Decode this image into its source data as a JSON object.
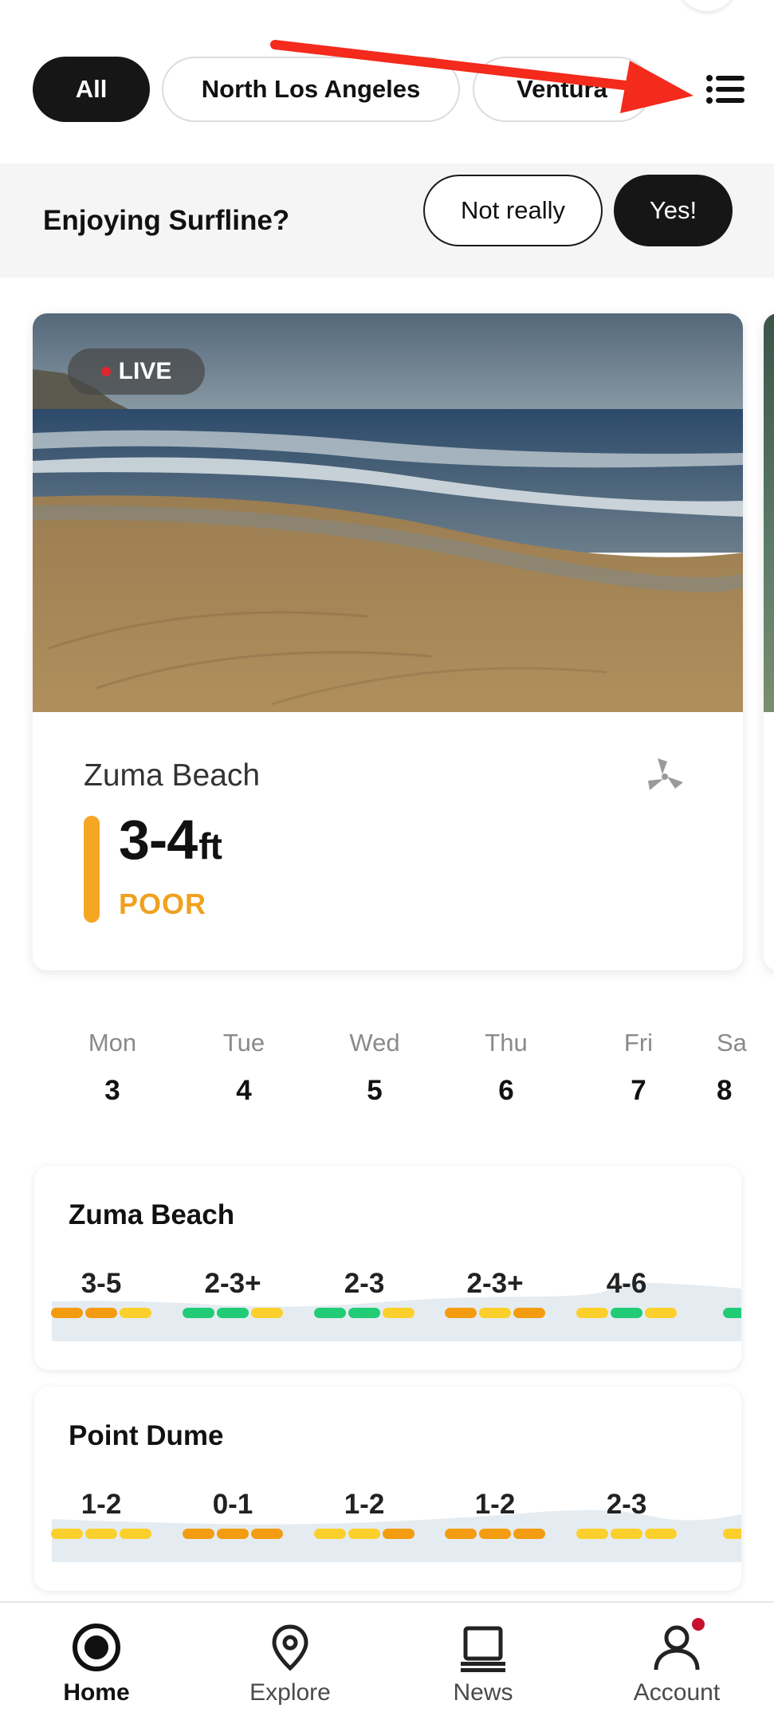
{
  "filters": {
    "chips": [
      {
        "label": "All",
        "active": true
      },
      {
        "label": "North Los Angeles",
        "active": false
      },
      {
        "label": "Ventura",
        "active": false
      }
    ],
    "list_icon": "list-icon"
  },
  "feedback": {
    "question": "Enjoying Surfline?",
    "no_label": "Not really",
    "yes_label": "Yes!"
  },
  "spot_card": {
    "live_label": "LIVE",
    "spot_name": "Zuma Beach",
    "height": "3-4",
    "unit": "ft",
    "rating": "POOR",
    "rating_color": "#f5a623",
    "wind_icon": "wind-icon"
  },
  "days": [
    {
      "dow": "Mon",
      "num": "3"
    },
    {
      "dow": "Tue",
      "num": "4"
    },
    {
      "dow": "Wed",
      "num": "5"
    },
    {
      "dow": "Thu",
      "num": "6"
    },
    {
      "dow": "Fri",
      "num": "7"
    },
    {
      "dow": "Sa",
      "num": "8"
    }
  ],
  "forecasts": [
    {
      "name": "Zuma Beach",
      "days": [
        {
          "range": "3-5",
          "segs": [
            "#f39c12",
            "#f39c12",
            "#fcd02c"
          ]
        },
        {
          "range": "2-3+",
          "segs": [
            "#22cc77",
            "#22cc77",
            "#fcd02c"
          ]
        },
        {
          "range": "2-3",
          "segs": [
            "#22cc77",
            "#22cc77",
            "#fcd02c"
          ]
        },
        {
          "range": "2-3+",
          "segs": [
            "#f39c12",
            "#fcd02c",
            "#f39c12"
          ]
        },
        {
          "range": "4-6",
          "segs": [
            "#fcd02c",
            "#22cc77",
            "#fcd02c"
          ]
        },
        {
          "range": "",
          "segs": [
            "#22cc77"
          ]
        }
      ]
    },
    {
      "name": "Point Dume",
      "days": [
        {
          "range": "1-2",
          "segs": [
            "#fcd02c",
            "#fcd02c",
            "#fcd02c"
          ]
        },
        {
          "range": "0-1",
          "segs": [
            "#f39c12",
            "#f39c12",
            "#f39c12"
          ]
        },
        {
          "range": "1-2",
          "segs": [
            "#fcd02c",
            "#fcd02c",
            "#f39c12"
          ]
        },
        {
          "range": "1-2",
          "segs": [
            "#f39c12",
            "#f39c12",
            "#f39c12"
          ]
        },
        {
          "range": "2-3",
          "segs": [
            "#fcd02c",
            "#fcd02c",
            "#fcd02c"
          ]
        },
        {
          "range": "",
          "segs": [
            "#fcd02c"
          ]
        }
      ]
    }
  ],
  "nav": {
    "items": [
      {
        "label": "Home",
        "icon": "home-icon",
        "active": true
      },
      {
        "label": "Explore",
        "icon": "map-pin-icon",
        "active": false
      },
      {
        "label": "News",
        "icon": "news-icon",
        "active": false
      },
      {
        "label": "Account",
        "icon": "account-icon",
        "active": false
      }
    ]
  }
}
